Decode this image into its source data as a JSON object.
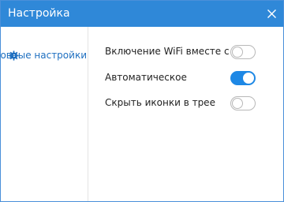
{
  "window": {
    "title": "Настройка"
  },
  "sidebar": {
    "items": [
      {
        "label": "Основные настройки",
        "icon": "gear-icon"
      }
    ]
  },
  "settings": [
    {
      "label": "Включение WiFi вместе с ПК",
      "enabled": false
    },
    {
      "label": "Автоматическое разделение WiFi",
      "enabled": true
    },
    {
      "label": "Скрыть иконки в трее",
      "enabled": false
    }
  ],
  "colors": {
    "titlebar": "#2f88d8",
    "accent": "#1e88e5",
    "sidebar_text": "#1e6fc0"
  }
}
